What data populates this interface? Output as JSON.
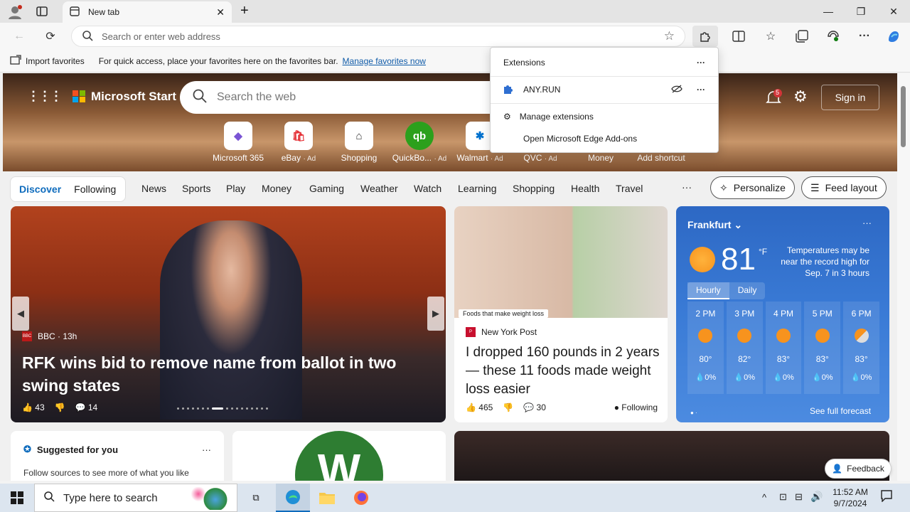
{
  "browser": {
    "tab_title": "New tab",
    "address_placeholder": "Search or enter web address"
  },
  "favbar": {
    "import_label": "Import favorites",
    "message": "For quick access, place your favorites here on the favorites bar.",
    "manage_link": "Manage favorites now"
  },
  "extensions_popup": {
    "title": "Extensions",
    "items": [
      {
        "label": "ANY.RUN"
      }
    ],
    "manage": "Manage extensions",
    "addons": "Open Microsoft Edge Add-ons"
  },
  "header": {
    "brand": "Microsoft Start",
    "search_placeholder": "Search the web",
    "notification_count": "5",
    "signin": "Sign in"
  },
  "quicklinks": [
    {
      "label": "Microsoft 365",
      "ad": ""
    },
    {
      "label": "eBay",
      "ad": "· Ad"
    },
    {
      "label": "Shopping",
      "ad": ""
    },
    {
      "label": "QuickBo...",
      "ad": "· Ad"
    },
    {
      "label": "Walmart",
      "ad": "· Ad"
    },
    {
      "label": "QVC",
      "ad": "· Ad"
    },
    {
      "label": "Money",
      "ad": ""
    },
    {
      "label": "Add shortcut",
      "ad": ""
    }
  ],
  "nav": {
    "pills": [
      "Discover",
      "Following"
    ],
    "items": [
      "News",
      "Sports",
      "Play",
      "Money",
      "Gaming",
      "Weather",
      "Watch",
      "Learning",
      "Shopping",
      "Health",
      "Travel"
    ],
    "more": "···",
    "personalize": "Personalize",
    "feed_layout": "Feed layout"
  },
  "feature_story": {
    "source": "BBC",
    "age": "13h",
    "source_age": "BBC · 13h",
    "headline": "RFK wins bid to remove name from ballot in two swing states",
    "likes": "43",
    "comments": "14"
  },
  "story2": {
    "image_tag": "Foods that make weight loss",
    "source": "New York Post",
    "headline": "I dropped 160 pounds in 2 years — these 11 foods made weight loss easier",
    "likes": "465",
    "comments": "30",
    "following": "Following"
  },
  "weather": {
    "city": "Frankfurt",
    "temp": "81",
    "unit": "°F",
    "note": "Temperatures may be near the record high for Sep. 7 in 3 hours",
    "tabs": [
      "Hourly",
      "Daily"
    ],
    "hours": [
      {
        "time": "2 PM",
        "temp": "80°",
        "precip": "0%"
      },
      {
        "time": "3 PM",
        "temp": "82°",
        "precip": "0%"
      },
      {
        "time": "4 PM",
        "temp": "83°",
        "precip": "0%"
      },
      {
        "time": "5 PM",
        "temp": "83°",
        "precip": "0%"
      },
      {
        "time": "6 PM",
        "temp": "83°",
        "precip": "0%"
      }
    ],
    "full_forecast": "See full forecast"
  },
  "suggested": {
    "title": "Suggested for you",
    "subtitle": "Follow sources to see more of what you like"
  },
  "feedback": "Feedback",
  "taskbar": {
    "search_placeholder": "Type here to search",
    "time": "11:52 AM",
    "date": "9/7/2024"
  },
  "colors": {
    "accent": "#0f6cbd",
    "weather_bg": "#3a7bd6"
  }
}
